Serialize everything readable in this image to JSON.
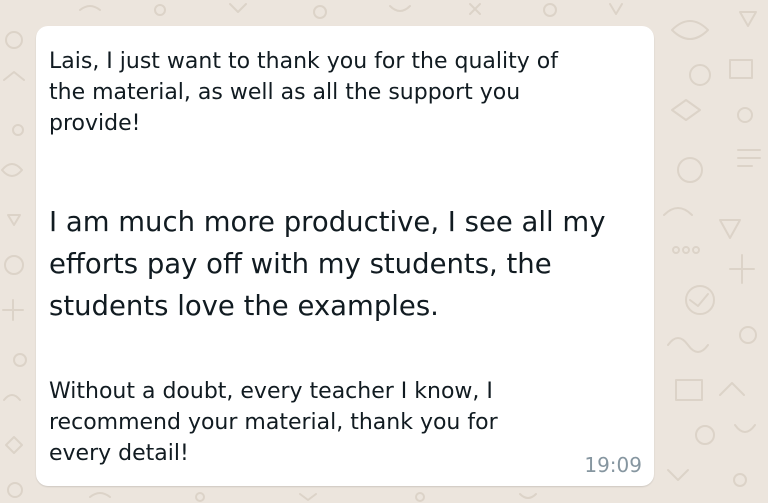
{
  "chat": {
    "background_color": "#ECE5DD",
    "bubble_color": "#FFFFFF",
    "message": {
      "paragraph_1": "Lais, I just want to thank you for the quality of\nthe material, as well as all the support you\nprovide!",
      "paragraph_2": "I am much more productive, I see all my\nefforts pay off with my students, the\nstudents love the examples.",
      "paragraph_3": "Without a doubt, every teacher I know, I\nrecommend your material, thank you for\nevery detail!",
      "time": "19:09"
    }
  }
}
